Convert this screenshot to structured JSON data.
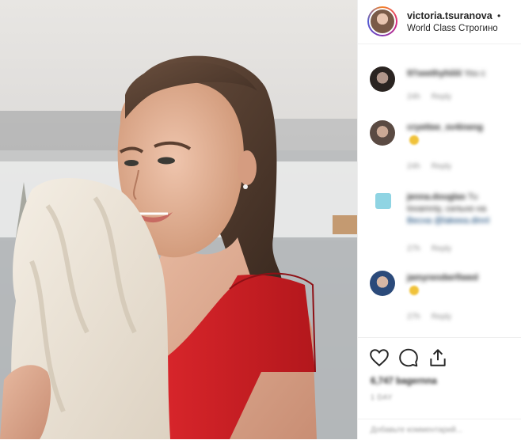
{
  "post": {
    "username": "victoria.tsuranova",
    "separator": "•",
    "location": "World Class Строгино"
  },
  "comments": [
    {
      "username": "97seethyhiiiii",
      "text": "You c",
      "time": "24h",
      "reply": "Reply",
      "has_emoji": false
    },
    {
      "username": "cryettee_sv4ineng",
      "text": "",
      "time": "24h",
      "reply": "Reply",
      "has_emoji": true
    },
    {
      "username": "jenna.douglas",
      "text": "Tu",
      "line2": "lovamniy, сильно на",
      "line3": "Весна @lakeea.dinnl",
      "time": "27h",
      "reply": "Reply",
      "has_emoji": false
    },
    {
      "username": "jamyrendwrfiwed",
      "text": "",
      "time": "27h",
      "reply": "Reply",
      "has_emoji": true
    }
  ],
  "actions": {
    "likes": "6,747 bagernna",
    "date": "1 DAY"
  },
  "add_comment": {
    "placeholder": "Добавьте комментарий..."
  },
  "icons": [
    "heart-icon",
    "comment-icon",
    "share-icon"
  ]
}
